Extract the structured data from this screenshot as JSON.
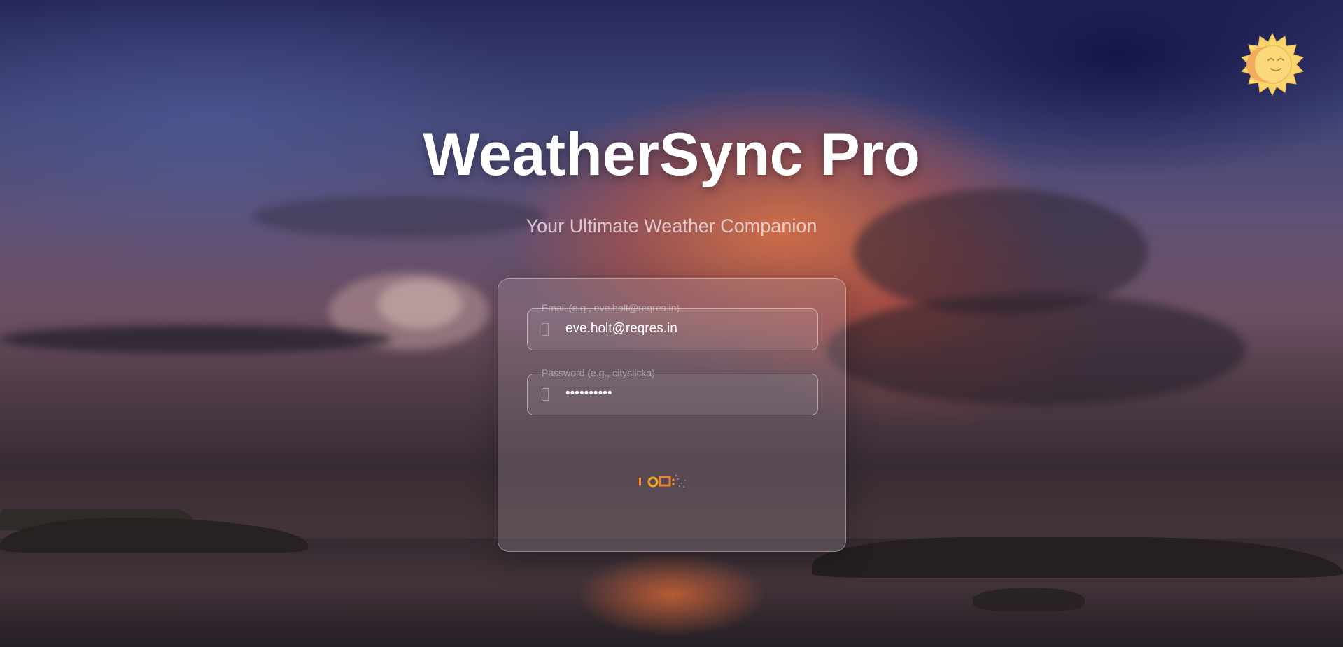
{
  "app": {
    "title": "WeatherSync Pro",
    "subtitle": "Your Ultimate Weather Companion"
  },
  "theme_toggle": {
    "icon": "sun-icon",
    "color": "#F9D56E"
  },
  "login_form": {
    "email": {
      "label": "Email (e.g., eve.holt@reqres.in)",
      "value": "eve.holt@reqres.in",
      "icon": "email-icon"
    },
    "password": {
      "label": "Password (e.g., cityslicka)",
      "value": "••••••••••",
      "icon": "lock-icon"
    },
    "loading_indicator": "loading-spinner-icon"
  },
  "colors": {
    "title_text": "#FFFFFF",
    "accent_orange": "#F28C28",
    "card_border": "rgba(255,255,255,0.35)"
  }
}
